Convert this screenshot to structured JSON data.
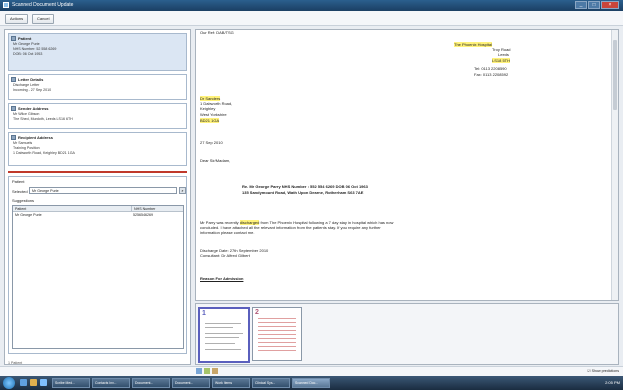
{
  "window": {
    "title": "Scanned Document Update"
  },
  "toolbar": {
    "btn1": "Actions",
    "btn2": "Cancel"
  },
  "sections": [
    {
      "title": "Patient",
      "lines": [
        "Mr George Purie",
        "NHS Number: 52 558 6269",
        "DOB: 06 Oct 1953"
      ]
    },
    {
      "title": "Letter Details",
      "lines": [
        "Discharge Letter",
        "Incoming - 27 Sep 2010"
      ]
    },
    {
      "title": "Sender Address",
      "lines": [
        "Mr Wilce Gibson",
        "The Shed, Murdoth, Leeds LS16 6TH"
      ]
    },
    {
      "title": "Recipient Address",
      "lines": [
        "Mr Samuels",
        "Training Position",
        "1 Dabworth Road, Keighley BD21 1GA"
      ]
    }
  ],
  "patient_panel": {
    "label": "Patient",
    "selected_label": "Selected",
    "selected_value": "Mr George Purie",
    "suggestions_label": "Suggestions",
    "columns": [
      "Patient",
      "NHS Number"
    ],
    "rows": [
      [
        "Mr George Purie",
        "5256546269"
      ]
    ]
  },
  "left_footer": "1 Patient",
  "letter": {
    "top_line": "Our Ref: DAB/TSG",
    "hospital": [
      "The Phoenix Hospital",
      "Troy Road",
      "Leeds",
      "LS18 5TH"
    ],
    "tel": "Tel: 0113 2208590",
    "fax": "Fax: 0113 2208592",
    "recipient": [
      "Dr Sanders",
      "1 Dabworth Road,",
      "Keighley",
      "West Yorkshire",
      "BD21 1GA"
    ],
    "date": "27 Sep 2010",
    "salutation": "Dear Sir/Madam,",
    "re_line1": "Re. Mr George Parry NHS Number : 552 554 6269 DOB 06 Oct 1963",
    "re_line2": "135 Sandymount Road, Wath Upon Dearne, Rotherham S63 7AE",
    "body_pre": "Mr Parry was recently ",
    "body_hl": "discharged",
    "body_post": " from The Phoenix Hospital following a 7 day stay in hospital which has now",
    "body2": "concluded. I have attached all the relevant information from the patients stay. If you require any further",
    "body3": "information please contact me.",
    "discharge_date": "Discharge Date: 27th September 2010",
    "consultant": "Consultant: Dr Alfred Gilbert",
    "reason": "Reason For Admission"
  },
  "thumbnails": [
    {
      "num": "1"
    },
    {
      "num": "2"
    }
  ],
  "status": {
    "checkbox": "Show predictions"
  },
  "taskbar": {
    "apps": [
      "Scribe Med...",
      "Contacts Inv...",
      "Document...",
      "Document...",
      "Work Items",
      "Clinical Sys...",
      "Scanned Doc..."
    ],
    "clock": "2:05 PM"
  }
}
